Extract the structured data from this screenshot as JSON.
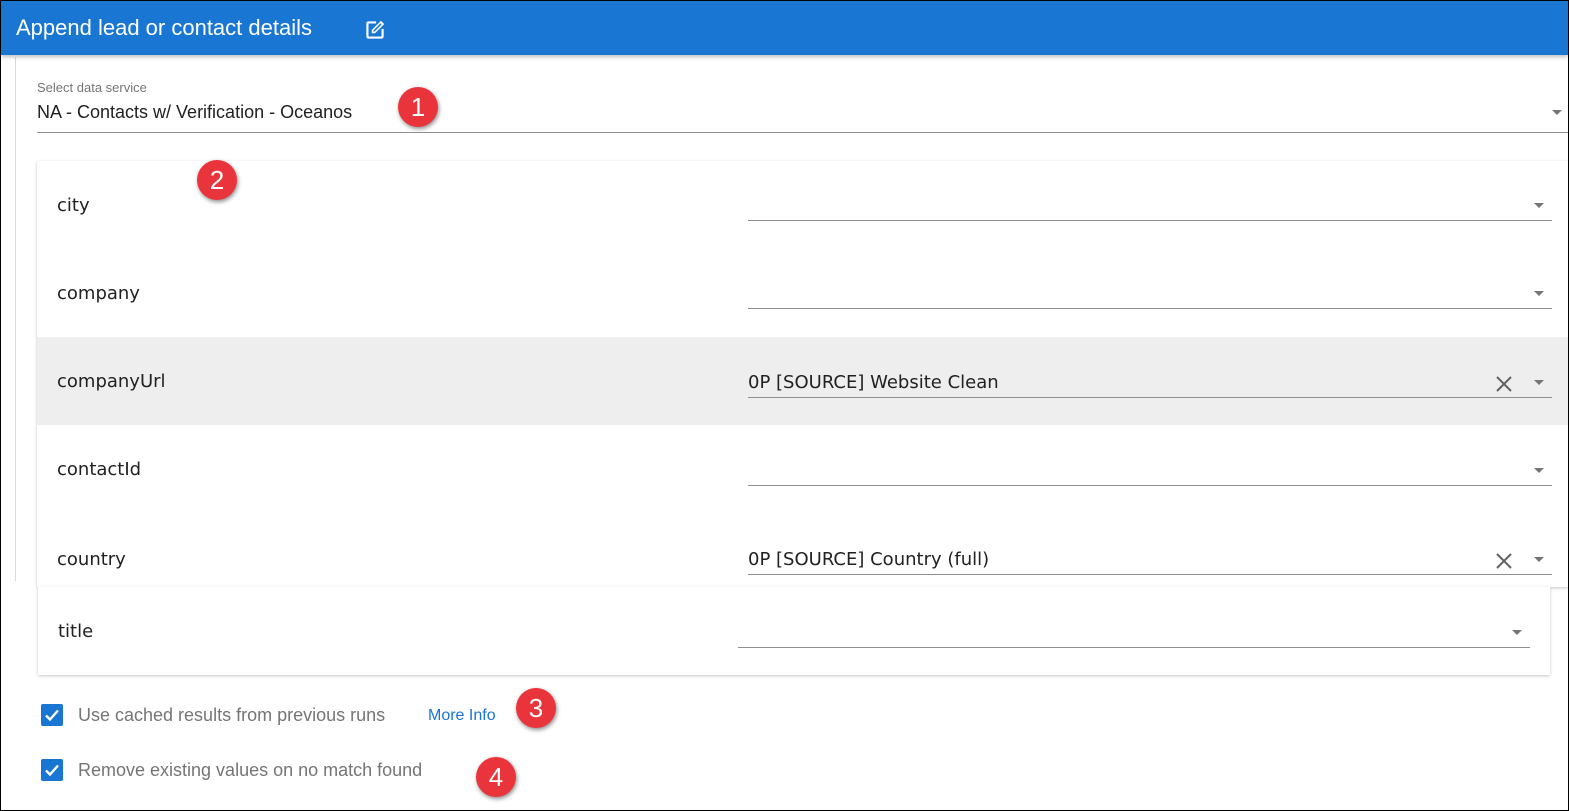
{
  "header": {
    "title": "Append lead or contact details",
    "edit_icon": "edit-square-icon",
    "color": "#1976d2"
  },
  "service": {
    "label": "Select data service",
    "value": "NA - Contacts w/ Verification - Oceanos"
  },
  "mappings": [
    {
      "field": "city",
      "value": ""
    },
    {
      "field": "company",
      "value": ""
    },
    {
      "field": "companyUrl",
      "value": "0P [SOURCE] Website Clean"
    },
    {
      "field": "contactId",
      "value": ""
    },
    {
      "field": "country",
      "value": "0P [SOURCE] Country (full)"
    },
    {
      "field": "title",
      "value": ""
    }
  ],
  "options": {
    "use_cached": {
      "label": "Use cached results from previous runs",
      "checked": true,
      "link": "More Info"
    },
    "remove_existing": {
      "label": "Remove existing values on no match found",
      "checked": true
    }
  },
  "badges": [
    "1",
    "2",
    "3",
    "4"
  ],
  "badge_color": "#e8343a"
}
